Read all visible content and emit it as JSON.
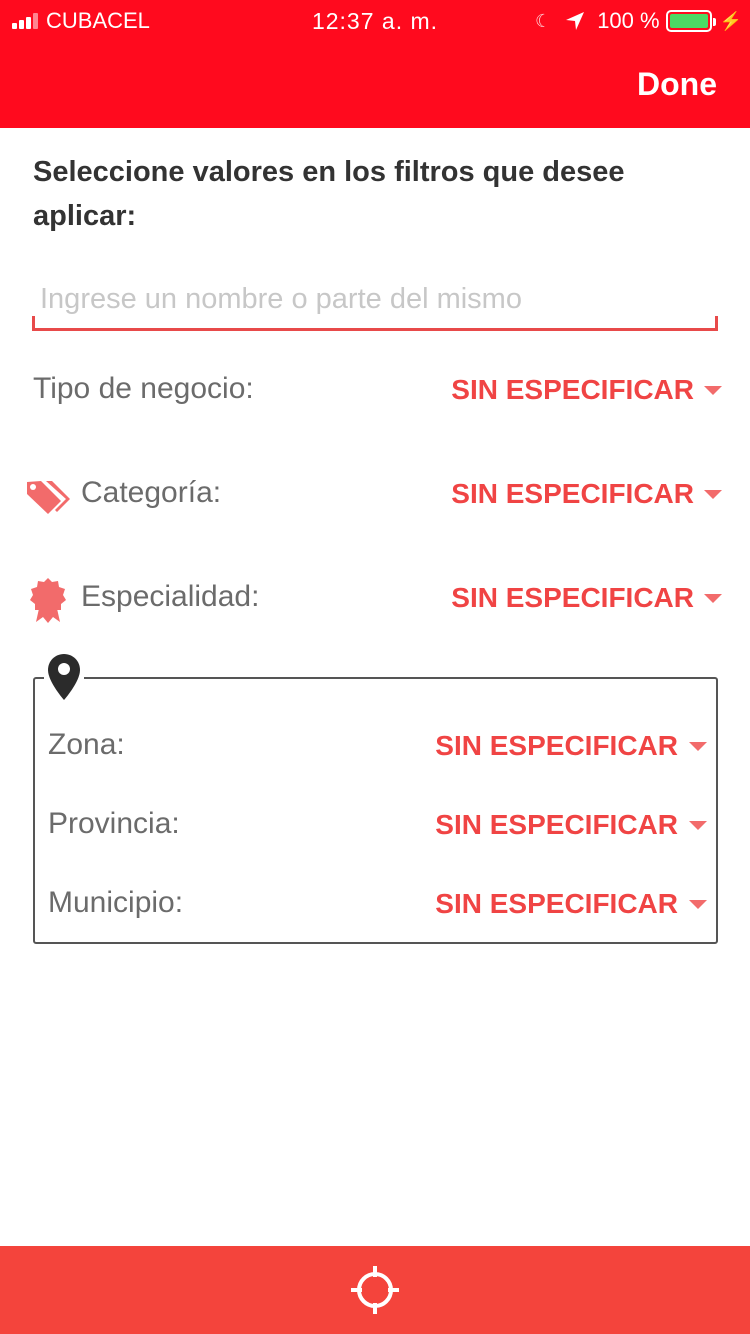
{
  "status_bar": {
    "carrier": "CUBACEL",
    "time": "12:37 a. m.",
    "battery": "100 %"
  },
  "header": {
    "done_label": "Done",
    "accent_color": "#ff0a1e"
  },
  "instructions": "Seleccione valores en los filtros que desee aplicar:",
  "search": {
    "value": "",
    "placeholder": "Ingrese un nombre o parte del mismo"
  },
  "filters": {
    "tipo": {
      "label": "Tipo de negocio:",
      "value": "SIN ESPECIFICAR"
    },
    "categoria": {
      "label": "Categoría:",
      "value": "SIN ESPECIFICAR",
      "icon": "tags-icon"
    },
    "especialidad": {
      "label": "Especialidad:",
      "value": "SIN ESPECIFICAR",
      "icon": "badge-icon"
    }
  },
  "location": {
    "icon": "map-pin-icon",
    "zona": {
      "label": "Zona:",
      "value": "SIN ESPECIFICAR"
    },
    "provincia": {
      "label": "Provincia:",
      "value": "SIN ESPECIFICAR"
    },
    "municipio": {
      "label": "Municipio:",
      "value": "SIN ESPECIFICAR"
    }
  },
  "footer": {
    "icon": "crosshair-icon",
    "color": "#f4443c"
  }
}
